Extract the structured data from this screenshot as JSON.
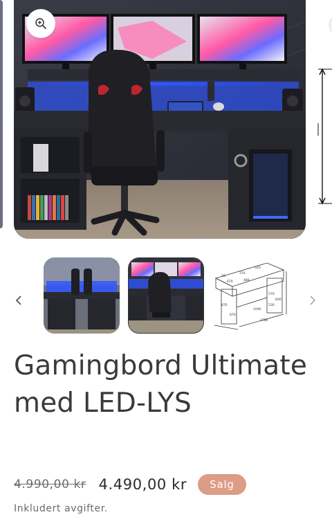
{
  "gallery": {
    "zoom_icon": "zoom-in-icon",
    "prev_icon": "chevron-left-icon",
    "next_icon": "chevron-right-icon",
    "thumbnails": [
      {
        "name": "desk-front-view"
      },
      {
        "name": "desk-chair-view"
      },
      {
        "name": "desk-dimensions-drawing"
      }
    ],
    "drawing_labels": [
      "1780",
      "1090",
      "870",
      "870",
      "530",
      "600",
      "370",
      "570",
      "480",
      "520",
      "50",
      "670"
    ]
  },
  "product": {
    "title": "Gamingbord Ultimate med LED-LYS",
    "compare_price": "4.990,00 kr",
    "price": "4.490,00 kr",
    "badge": "Salg",
    "tax_note": "Inkludert avgifter."
  },
  "colors": {
    "badge_bg": "#dd9c87",
    "led_blue": "#2f56ff",
    "title_text": "#3a3a3a"
  }
}
